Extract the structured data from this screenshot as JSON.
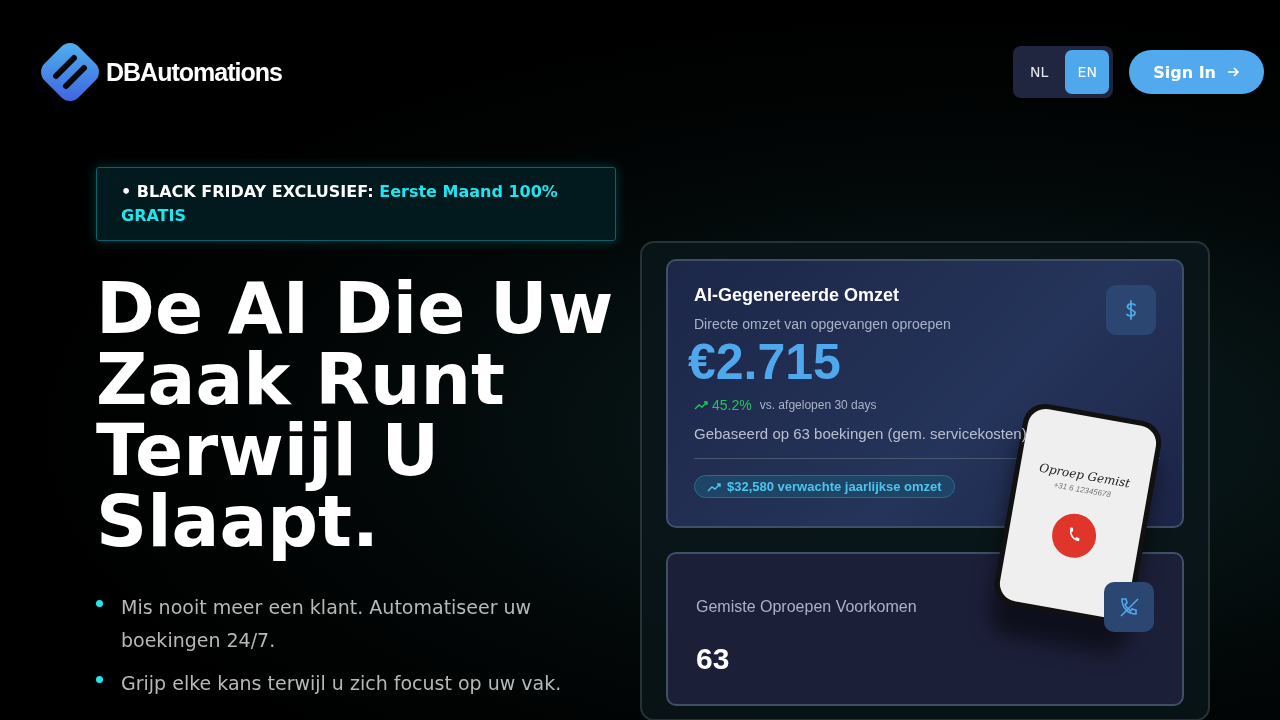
{
  "header": {
    "logo_text": "DBAutomations",
    "languages": [
      {
        "label": "NL",
        "selected": false
      },
      {
        "label": "EN",
        "selected": true
      }
    ],
    "sign_in": "Sign In"
  },
  "promo": {
    "label": "• BLACK FRIDAY EXCLUSIEF:",
    "highlight": "Eerste Maand 100% GRATIS"
  },
  "headline": "De AI Die Uw Zaak Runt Terwijl U Slaapt.",
  "bullets": [
    "Mis nooit meer een klant. Automatiseer uw boekingen 24/7.",
    "Grijp elke kans terwijl u zich focust op uw vak."
  ],
  "dashboard": {
    "revenue_card": {
      "title": "AI-Gegenereerde Omzet",
      "subtitle": "Directe omzet van opgevangen oproepen",
      "amount": "€2.715",
      "change": "45.2%",
      "change_note": "vs. afgelopen 30 days",
      "basis": "Gebaseerd op 63 boekingen (gem. servicekosten)",
      "projection": "$32,580 verwachte jaarlijkse omzet"
    },
    "missed_card": {
      "title": "Gemiste Oproepen Voorkomen",
      "value": "63"
    },
    "phone": {
      "title": "Oproep Gemist",
      "number": "+31 6 12345678"
    }
  }
}
